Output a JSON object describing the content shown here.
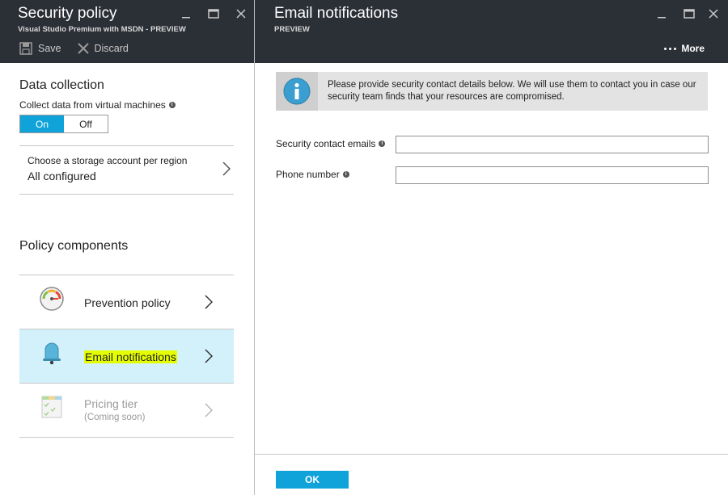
{
  "left_blade": {
    "title": "Security policy",
    "subtitle": "Visual Studio Premium with MSDN - PREVIEW",
    "toolbar": {
      "save_label": "Save",
      "discard_label": "Discard"
    },
    "data_collection": {
      "heading": "Data collection",
      "collect_label": "Collect data from virtual machines",
      "toggle_on": "On",
      "toggle_off": "Off",
      "selected": "On"
    },
    "storage": {
      "label": "Choose a storage account per region",
      "value": "All configured"
    },
    "policy_components": {
      "heading": "Policy components",
      "items": [
        {
          "label": "Prevention policy",
          "icon": "gauge-icon"
        },
        {
          "label": "Email notifications",
          "icon": "bell-icon",
          "selected": true
        },
        {
          "label": "Pricing tier",
          "note": "(Coming soon)",
          "icon": "pricing-icon",
          "disabled": true
        }
      ]
    }
  },
  "right_blade": {
    "title": "Email notifications",
    "subtitle": "PREVIEW",
    "more_label": "More",
    "info_message": "Please provide security contact details below. We will use them to contact you in case our security team finds that your resources are compromised.",
    "fields": {
      "emails_label": "Security contact emails",
      "emails_value": "",
      "phone_label": "Phone number",
      "phone_value": ""
    },
    "ok_label": "OK"
  },
  "colors": {
    "header_bg": "#2b2f36",
    "accent": "#0fa3d9",
    "selected_row": "#d2f1fb",
    "highlight": "#e6ff00"
  }
}
